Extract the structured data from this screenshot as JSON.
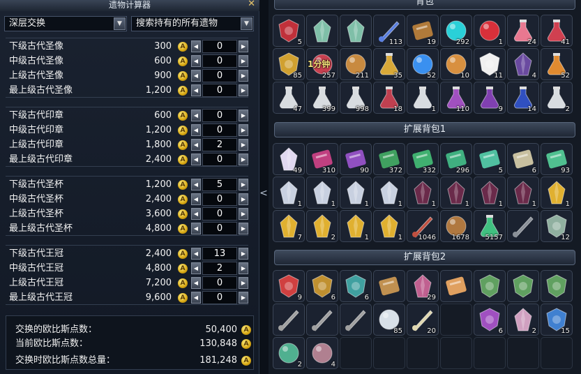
{
  "calculator": {
    "title": "遗物计算器",
    "close_glyph": "✕",
    "exchange_select": "深层交换",
    "search_select": "搜索持有的所有遗物",
    "dropdown_glyph": "▼",
    "coin_glyph": "A",
    "dec_glyph": "◀",
    "inc_glyph": "▶",
    "groups": [
      {
        "rows": [
          {
            "name": "下级古代圣像",
            "price": "300",
            "qty": "0"
          },
          {
            "name": "中级古代圣像",
            "price": "600",
            "qty": "0"
          },
          {
            "name": "上级古代圣像",
            "price": "900",
            "qty": "0"
          },
          {
            "name": "最上级古代圣像",
            "price": "1,200",
            "qty": "0"
          }
        ]
      },
      {
        "rows": [
          {
            "name": "下级古代印章",
            "price": "600",
            "qty": "0"
          },
          {
            "name": "中级古代印章",
            "price": "1,200",
            "qty": "0"
          },
          {
            "name": "上级古代印章",
            "price": "1,800",
            "qty": "2"
          },
          {
            "name": "最上级古代印章",
            "price": "2,400",
            "qty": "0"
          }
        ]
      },
      {
        "rows": [
          {
            "name": "下级古代圣杯",
            "price": "1,200",
            "qty": "5"
          },
          {
            "name": "中级古代圣杯",
            "price": "2,400",
            "qty": "0"
          },
          {
            "name": "上级古代圣杯",
            "price": "3,600",
            "qty": "0"
          },
          {
            "name": "最上级古代圣杯",
            "price": "4,800",
            "qty": "0"
          }
        ]
      },
      {
        "rows": [
          {
            "name": "下级古代王冠",
            "price": "2,400",
            "qty": "13"
          },
          {
            "name": "中级古代王冠",
            "price": "4,800",
            "qty": "2"
          },
          {
            "name": "上级古代王冠",
            "price": "7,200",
            "qty": "0"
          },
          {
            "name": "最上级古代王冠",
            "price": "9,600",
            "qty": "0"
          }
        ]
      }
    ],
    "summary": [
      {
        "label": "交换的欧比斯点数：",
        "value": "50,400"
      },
      {
        "label": "当前欧比斯点数：",
        "value": "130,848"
      },
      {
        "label": "交换时欧比斯点数总量：",
        "value": "181,248"
      }
    ]
  },
  "collapse_glyph": "<",
  "inventory": {
    "sections": [
      {
        "title": "背包",
        "items": [
          {
            "icon": "red-plant",
            "count": "5",
            "color": "#c0303a"
          },
          {
            "icon": "green-stone",
            "count": "",
            "color": "#7fbfa8"
          },
          {
            "icon": "green-stone",
            "count": "",
            "color": "#7fbfa8"
          },
          {
            "icon": "blue-sword",
            "count": "113",
            "color": "#5a7fe0"
          },
          {
            "icon": "map-scroll",
            "count": "19",
            "color": "#b07a3a"
          },
          {
            "icon": "cyan-orb",
            "count": "292",
            "color": "#2ad0d8"
          },
          {
            "icon": "red-gem",
            "count": "1",
            "color": "#d8303a"
          },
          {
            "icon": "pink-drink",
            "count": "24",
            "color": "#e87890"
          },
          {
            "icon": "cocktail",
            "count": "41",
            "color": "#d04050"
          },
          {
            "icon": "food-plate",
            "count": "85",
            "color": "#d0a030"
          },
          {
            "icon": "cake-timer",
            "count": "257",
            "color": "#c84050",
            "tag": "1分钟"
          },
          {
            "icon": "bread-bowl",
            "count": "211",
            "color": "#c88a40"
          },
          {
            "icon": "gold-urn",
            "count": "35",
            "color": "#d8a838"
          },
          {
            "icon": "blue-orb",
            "count": "52",
            "color": "#3a90f0"
          },
          {
            "icon": "biscuit",
            "count": "10",
            "color": "#d89040"
          },
          {
            "icon": "polar-bear",
            "count": "11",
            "color": "#f0f0f0"
          },
          {
            "icon": "dark-crystal",
            "count": "4",
            "color": "#6a4aa0"
          },
          {
            "icon": "orange-potion",
            "count": "52",
            "color": "#e08a30"
          },
          {
            "icon": "white-flask",
            "count": "47",
            "color": "#d8dce0"
          },
          {
            "icon": "white-flask",
            "count": "399",
            "color": "#d8dce0"
          },
          {
            "icon": "white-flask",
            "count": "998",
            "color": "#d8dce0"
          },
          {
            "icon": "red-flask",
            "count": "18",
            "color": "#c04050"
          },
          {
            "icon": "white-flask",
            "count": "1",
            "color": "#d8dce0"
          },
          {
            "icon": "purple-flask",
            "count": "110",
            "color": "#a050c0"
          },
          {
            "icon": "purple-flask",
            "count": "9",
            "color": "#8040b0"
          },
          {
            "icon": "blue-flask",
            "count": "14",
            "color": "#3050c0"
          },
          {
            "icon": "white-flask",
            "count": "2",
            "color": "#d8dce0"
          }
        ]
      },
      {
        "title": "扩展背包1",
        "items": [
          {
            "icon": "white-crystal",
            "count": "49",
            "color": "#e0d8f0"
          },
          {
            "icon": "rune-card",
            "count": "310",
            "color": "#c04080"
          },
          {
            "icon": "rune-card",
            "count": "90",
            "color": "#9050c0"
          },
          {
            "icon": "rune-card",
            "count": "372",
            "color": "#40a060"
          },
          {
            "icon": "rune-card",
            "count": "332",
            "color": "#40b070"
          },
          {
            "icon": "rune-card",
            "count": "296",
            "color": "#40b080"
          },
          {
            "icon": "rune-card",
            "count": "5",
            "color": "#50c0a0"
          },
          {
            "icon": "scroll",
            "count": "6",
            "color": "#c8c0a0"
          },
          {
            "icon": "rune-card",
            "count": "93",
            "color": "#50c090"
          },
          {
            "icon": "silver-ore",
            "count": "1",
            "color": "#c8d0e0"
          },
          {
            "icon": "silver-ore",
            "count": "1",
            "color": "#c8d0e0"
          },
          {
            "icon": "silver-ore",
            "count": "1",
            "color": "#c8d0e0"
          },
          {
            "icon": "silver-ore",
            "count": "1",
            "color": "#c8d0e0"
          },
          {
            "icon": "purple-rune-stone",
            "count": "1",
            "color": "#6a2a4a"
          },
          {
            "icon": "purple-rune-stone",
            "count": "1",
            "color": "#6a2a4a"
          },
          {
            "icon": "purple-rune-stone",
            "count": "1",
            "color": "#6a2a4a"
          },
          {
            "icon": "purple-rune-stone",
            "count": "1",
            "color": "#6a2a4a"
          },
          {
            "icon": "gold-star-shard",
            "count": "1",
            "color": "#e0b030"
          },
          {
            "icon": "gold-star-shard",
            "count": "7",
            "color": "#e0b030"
          },
          {
            "icon": "gold-star-shard",
            "count": "2",
            "color": "#e0b030"
          },
          {
            "icon": "gold-star-shard",
            "count": "1",
            "color": "#e0b030"
          },
          {
            "icon": "gold-star-shard",
            "count": "1",
            "color": "#e0b030"
          },
          {
            "icon": "red-feather",
            "count": "1046",
            "color": "#c05040"
          },
          {
            "icon": "coin-bag",
            "count": "1678",
            "color": "#b07840"
          },
          {
            "icon": "green-flask",
            "count": "5157",
            "color": "#40c080"
          },
          {
            "icon": "iron-bars",
            "count": "",
            "color": "#8a9098"
          },
          {
            "icon": "gold-emblem",
            "count": "12",
            "color": "#90b0a0"
          }
        ]
      },
      {
        "title": "扩展背包2",
        "items": [
          {
            "icon": "red-mushroom",
            "count": "9",
            "color": "#d04040"
          },
          {
            "icon": "shield-emblem",
            "count": "6",
            "color": "#c09030"
          },
          {
            "icon": "shield-emblem",
            "count": "6",
            "color": "#40a0a0"
          },
          {
            "icon": "ancient-scroll",
            "count": "",
            "color": "#c09050"
          },
          {
            "icon": "pink-crystal",
            "count": "29",
            "color": "#c06090"
          },
          {
            "icon": "letter",
            "count": "",
            "color": "#e0a060"
          },
          {
            "icon": "green-wings",
            "count": "",
            "color": "#60a060"
          },
          {
            "icon": "green-wings",
            "count": "",
            "color": "#60a060"
          },
          {
            "icon": "green-wings",
            "count": "",
            "color": "#60a060"
          },
          {
            "icon": "key",
            "count": "",
            "color": "#a0a0a0"
          },
          {
            "icon": "key",
            "count": "",
            "color": "#a0a0a0"
          },
          {
            "icon": "key",
            "count": "",
            "color": "#a0a0a0"
          },
          {
            "icon": "silver-coin",
            "count": "85",
            "color": "#d8e0e8"
          },
          {
            "icon": "fang",
            "count": "20",
            "color": "#e0d8b0"
          },
          {
            "icon": "empty",
            "count": "",
            "color": ""
          },
          {
            "icon": "shield-emblem",
            "count": "6",
            "color": "#a050c0"
          },
          {
            "icon": "pink-seed",
            "count": "2",
            "color": "#d0a0c0"
          },
          {
            "icon": "blue-flower",
            "count": "15",
            "color": "#4080d0"
          },
          {
            "icon": "green-gem",
            "count": "2",
            "color": "#50b090"
          },
          {
            "icon": "pearl-stone",
            "count": "4",
            "color": "#b08090"
          },
          {
            "icon": "empty",
            "count": "",
            "color": ""
          },
          {
            "icon": "empty",
            "count": "",
            "color": ""
          },
          {
            "icon": "empty",
            "count": "",
            "color": ""
          },
          {
            "icon": "empty",
            "count": "",
            "color": ""
          },
          {
            "icon": "empty",
            "count": "",
            "color": ""
          },
          {
            "icon": "empty",
            "count": "",
            "color": ""
          },
          {
            "icon": "empty",
            "count": "",
            "color": ""
          }
        ]
      }
    ]
  }
}
